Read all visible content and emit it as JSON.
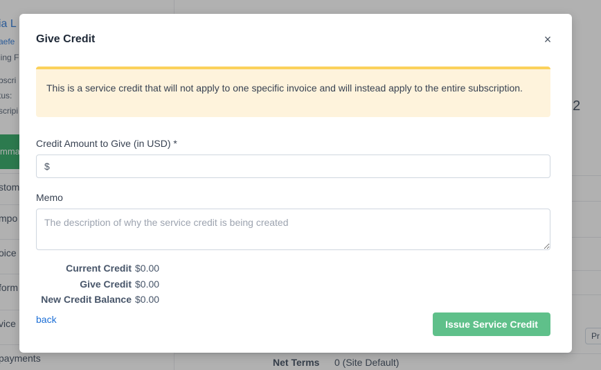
{
  "background": {
    "customer_name": "ia L",
    "customer_email": "aefe",
    "billing_fragment": "ling F",
    "subscr_fragment": "bscri",
    "status_fragment": "tus: ",
    "subscr_fragment2": "scripi",
    "green_tab_fragment": "mma",
    "nav_items": [
      "stom",
      "mpo",
      "oice",
      "form",
      "vice",
      "payments"
    ],
    "big_number_fragment": "22",
    "button_fragment": "Pr",
    "net_terms_label": "Net Terms",
    "net_terms_value": "0 (Site Default)"
  },
  "modal": {
    "title": "Give Credit",
    "close_glyph": "×",
    "notice": "This is a service credit that will not apply to one specific invoice and will instead apply to the entire subscription.",
    "amount_label": "Credit Amount to Give (in USD) *",
    "amount_prefix": "$",
    "amount_value": "",
    "memo_label": "Memo",
    "memo_placeholder": "The description of why the service credit is being created",
    "summary": {
      "current_credit_label": "Current Credit",
      "current_credit_value": "$0.00",
      "give_credit_label": "Give Credit",
      "give_credit_value": "$0.00",
      "new_balance_label": "New Credit Balance",
      "new_balance_value": "$0.00"
    },
    "back_label": "back",
    "issue_label": "Issue Service Credit"
  },
  "colors": {
    "link": "#1d6fd6",
    "notice_bg": "#fef3dc",
    "notice_border": "#fbd15b",
    "issue_button": "#5fc08a",
    "sidebar_active": "#22a35a"
  }
}
